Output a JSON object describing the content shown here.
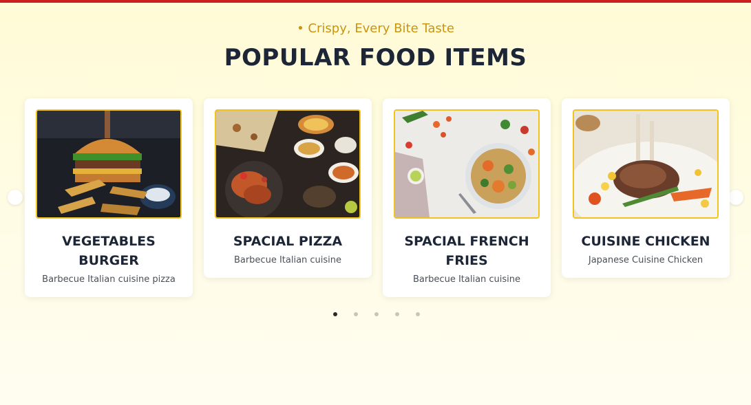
{
  "header": {
    "subtitle": "• Crispy, Every Bite Taste",
    "title": "POPULAR FOOD ITEMS"
  },
  "carousel": {
    "items": [
      {
        "title": "VEGETABLES BURGER",
        "description": "Barbecue Italian cuisine pizza",
        "image": "burger-image"
      },
      {
        "title": "SPACIAL PIZZA",
        "description": "Barbecue Italian cuisine",
        "image": "pizza-image"
      },
      {
        "title": "SPACIAL FRENCH FRIES",
        "description": "Barbecue Italian cuisine",
        "image": "salad-image"
      },
      {
        "title": "CUISINE CHICKEN",
        "description": "Japanese Cuisine Chicken",
        "image": "chicken-image"
      }
    ],
    "pagination": {
      "pages": 5,
      "active": 1
    }
  },
  "colors": {
    "accent": "#c99410",
    "heading": "#1d2636",
    "top_bar": "#cc1f1f",
    "image_border": "#f2c31c"
  }
}
